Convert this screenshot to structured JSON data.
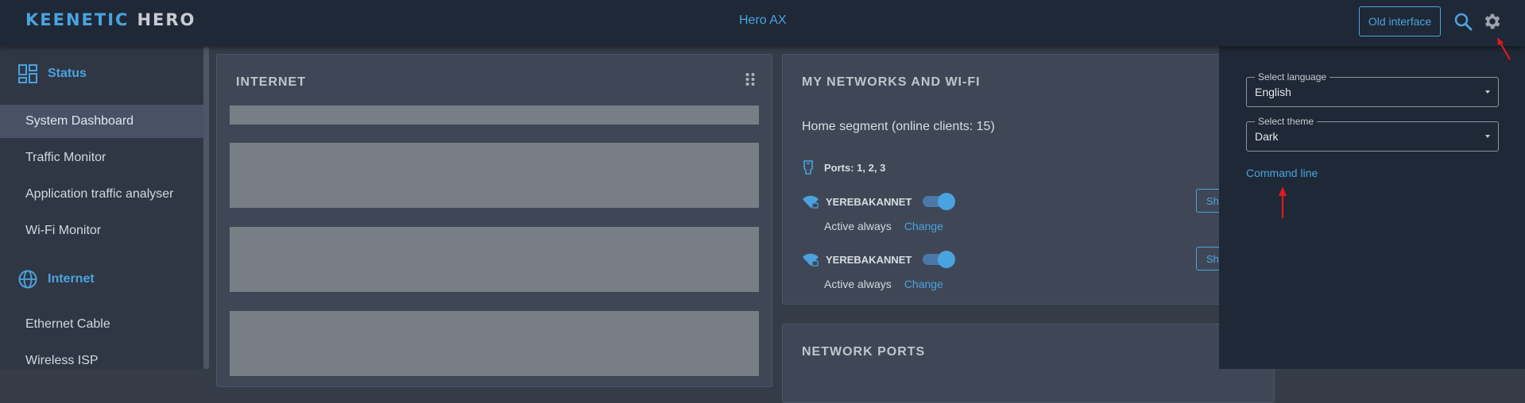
{
  "header": {
    "brand": "KEENETIC",
    "model": "HERO",
    "device_name": "Hero AX",
    "old_interface_label": "Old interface"
  },
  "sidebar": {
    "sections": [
      {
        "title": "Status",
        "icon": "dashboard-icon",
        "items": [
          "System Dashboard",
          "Traffic Monitor",
          "Application traffic analyser",
          "Wi-Fi Monitor"
        ]
      },
      {
        "title": "Internet",
        "icon": "globe-icon",
        "items": [
          "Ethernet Cable",
          "Wireless ISP"
        ]
      }
    ],
    "active_item": "System Dashboard"
  },
  "cards": {
    "internet": {
      "title": "INTERNET"
    },
    "networks": {
      "title": "MY NETWORKS AND WI-FI",
      "segment": "Home segment (online clients: 15)",
      "ports": "Ports: 1, 2, 3",
      "wifi": [
        {
          "name": "YEREBAKANNET",
          "enabled": true,
          "status": "Active always",
          "change_label": "Change",
          "show_label": "Sh"
        },
        {
          "name": "YEREBAKANNET",
          "enabled": true,
          "status": "Active always",
          "change_label": "Change",
          "show_label": "Sh"
        }
      ]
    },
    "network_ports": {
      "title": "NETWORK PORTS"
    }
  },
  "settings_panel": {
    "language": {
      "legend": "Select language",
      "value": "English"
    },
    "theme": {
      "legend": "Select theme",
      "value": "Dark"
    },
    "command_line_label": "Command line"
  },
  "colors": {
    "accent": "#4aa3df",
    "header_bg": "#1f2836",
    "annotation_arrow": "#e0191b"
  }
}
